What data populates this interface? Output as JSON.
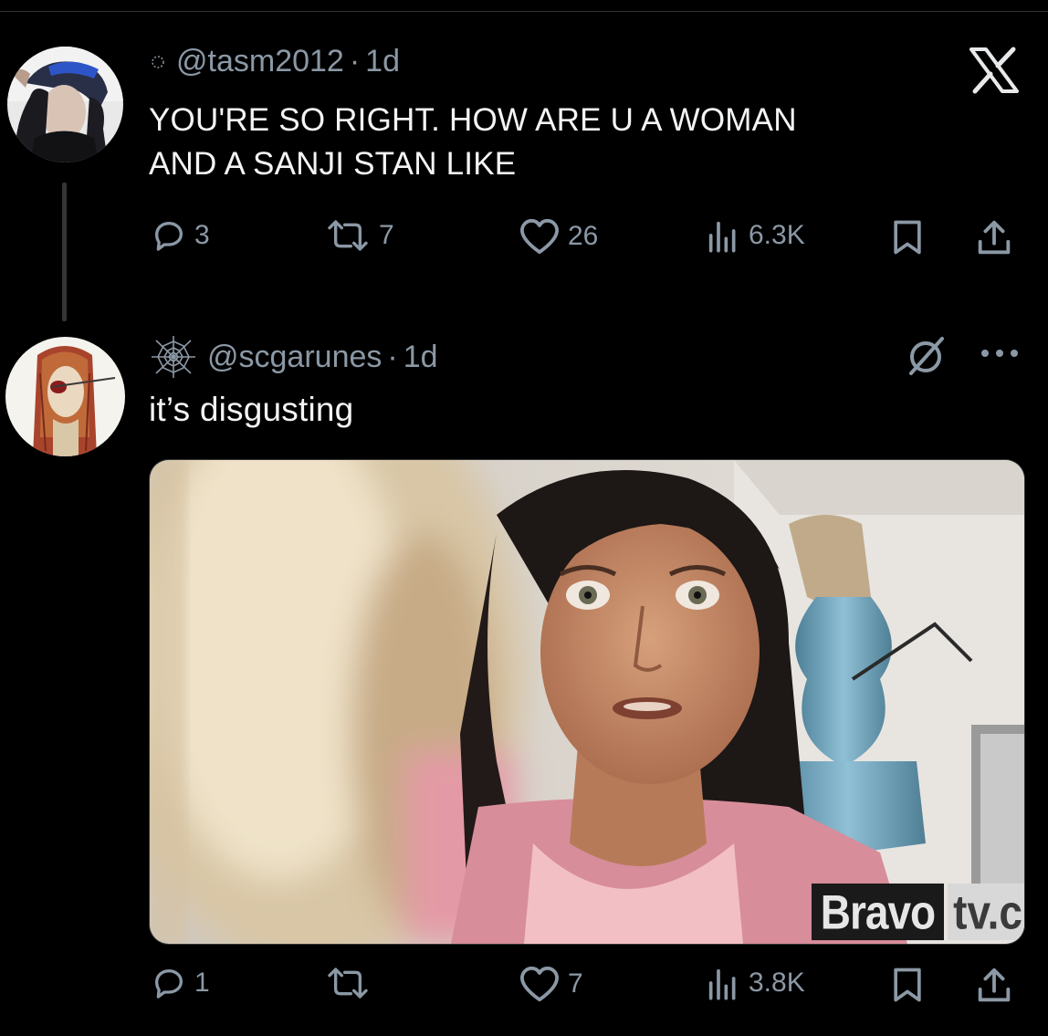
{
  "tweet1": {
    "handle": "@tasm2012",
    "separator": "·",
    "time": "1d",
    "text_line1": "YOU'RE SO RIGHT. HOW ARE U A WOMAN",
    "text_line2": "AND A SANJI STAN LIKE",
    "replies": "3",
    "reposts": "7",
    "likes": "26",
    "views": "6.3K"
  },
  "tweet2": {
    "handle": "@scgarunes",
    "separator": "·",
    "time": "1d",
    "text": "it’s disgusting",
    "replies": "1",
    "reposts": "",
    "likes": "7",
    "views": "3.8K",
    "media_watermark": {
      "part1": "Bravo",
      "part2": "tv.c"
    }
  },
  "colors": {
    "background": "#000000",
    "text": "#e7e9ea",
    "secondary": "#8b98a5",
    "divider": "#2f3336"
  },
  "icons": [
    "x-logo-icon",
    "reply-icon",
    "repost-icon",
    "like-icon",
    "views-icon",
    "bookmark-icon",
    "share-icon",
    "muted-icon",
    "more-icon",
    "spiderweb-icon"
  ]
}
